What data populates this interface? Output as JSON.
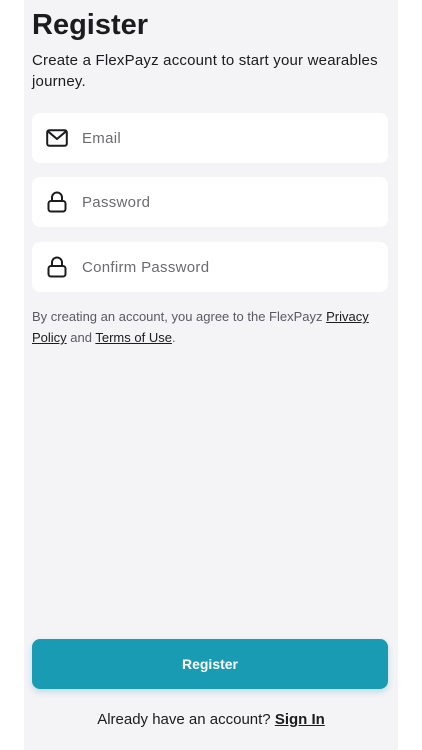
{
  "header": {
    "title": "Register",
    "subtitle": "Create a FlexPayz account to start your wearables journey."
  },
  "form": {
    "email": {
      "placeholder": "Email",
      "value": "",
      "icon": "mail-icon"
    },
    "password": {
      "placeholder": "Password",
      "value": "",
      "icon": "lock-icon"
    },
    "confirm_password": {
      "placeholder": "Confirm Password",
      "value": "",
      "icon": "lock-icon"
    }
  },
  "terms": {
    "prefix": "By creating an account, you agree to the FlexPayz ",
    "privacy_link": "Privacy Policy",
    "middle": " and ",
    "terms_link": "Terms of Use",
    "suffix": "."
  },
  "actions": {
    "register_label": "Register",
    "signin_prompt": "Already have an account?",
    "signin_link": "Sign In"
  },
  "colors": {
    "primary": "#1a9bb4",
    "background": "#f4f3f6",
    "field": "#ffffff",
    "text": "#1c1c1e"
  }
}
